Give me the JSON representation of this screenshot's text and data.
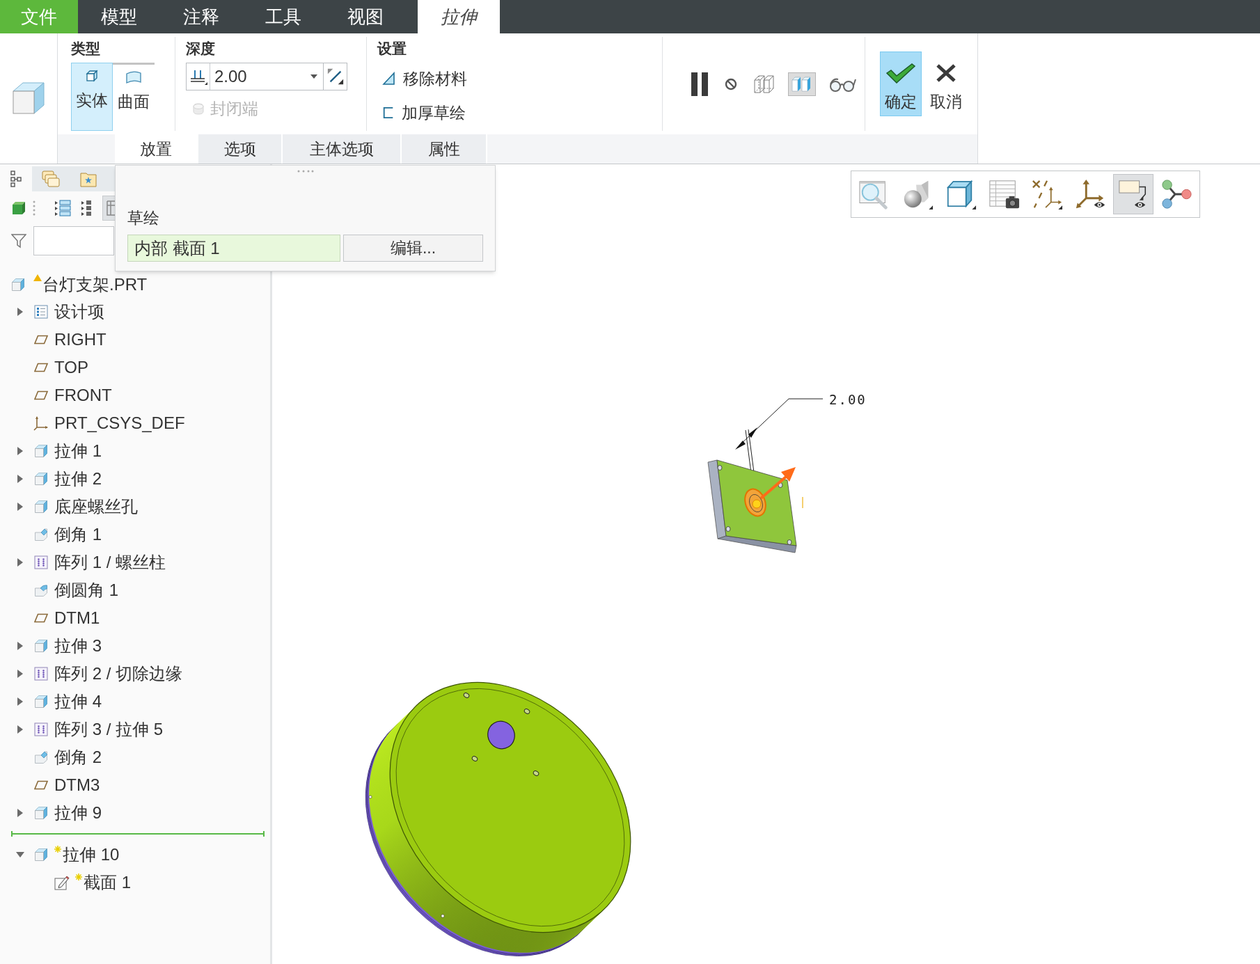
{
  "menu_tabs": [
    {
      "label": "文件",
      "kind": "file",
      "selected": false
    },
    {
      "label": "模型",
      "kind": "tab",
      "selected": false
    },
    {
      "label": "注释",
      "kind": "tab",
      "selected": false
    },
    {
      "label": "工具",
      "kind": "tab",
      "selected": false
    },
    {
      "label": "视图",
      "kind": "tab",
      "selected": false
    },
    {
      "label": "拉伸",
      "kind": "contextual",
      "selected": true
    }
  ],
  "ribbon": {
    "type_group": {
      "title": "类型",
      "options": [
        {
          "label": "实体",
          "kind": "solid",
          "selected": true
        },
        {
          "label": "曲面",
          "kind": "surface",
          "selected": false
        }
      ]
    },
    "depth_group": {
      "title": "深度",
      "value": "2.00",
      "capped_ends": {
        "label": "封闭端",
        "disabled": true
      }
    },
    "settings_group": {
      "title": "设置",
      "options": [
        {
          "label": "移除材料",
          "kind": "remove",
          "selected": false
        },
        {
          "label": "加厚草绘",
          "kind": "thicken",
          "selected": false
        }
      ]
    },
    "preview_buttons": [
      {
        "kind": "pause",
        "selected": false
      },
      {
        "kind": "no-preview",
        "selected": false
      },
      {
        "kind": "wireframe",
        "selected": false
      },
      {
        "kind": "shaded",
        "selected": true
      },
      {
        "kind": "glasses",
        "selected": false
      }
    ],
    "actions": [
      {
        "label": "确定",
        "kind": "confirm",
        "selected": true
      },
      {
        "label": "取消",
        "kind": "cancel",
        "selected": false
      }
    ],
    "sub_tabs": [
      {
        "label": "放置",
        "selected": true
      },
      {
        "label": "选项",
        "selected": false
      },
      {
        "label": "主体选项",
        "selected": false
      },
      {
        "label": "属性",
        "selected": false
      }
    ]
  },
  "placement_panel": {
    "title": "草绘",
    "sketch": "内部 截面 1",
    "edit_button": "编辑..."
  },
  "model_tree": {
    "tabs": [
      {
        "kind": "tree",
        "selected": true
      },
      {
        "kind": "layers",
        "selected": false
      },
      {
        "kind": "favorites",
        "selected": false
      }
    ],
    "root": {
      "label": "台灯支架.PRT",
      "warning": true
    },
    "items": [
      {
        "label": "设计项",
        "kind": "design-items",
        "expanded": false
      },
      {
        "label": "RIGHT",
        "kind": "plane"
      },
      {
        "label": "TOP",
        "kind": "plane"
      },
      {
        "label": "FRONT",
        "kind": "plane"
      },
      {
        "label": "PRT_CSYS_DEF",
        "kind": "csys"
      },
      {
        "label": "拉伸 1",
        "kind": "extrude",
        "expanded": false
      },
      {
        "label": "拉伸 2",
        "kind": "extrude",
        "expanded": false
      },
      {
        "label": "底座螺丝孔",
        "kind": "extrude",
        "expanded": false
      },
      {
        "label": "倒角 1",
        "kind": "chamfer"
      },
      {
        "label": "阵列 1 / 螺丝柱",
        "kind": "pattern",
        "expanded": false
      },
      {
        "label": "倒圆角 1",
        "kind": "round"
      },
      {
        "label": "DTM1",
        "kind": "plane"
      },
      {
        "label": "拉伸 3",
        "kind": "extrude",
        "expanded": false
      },
      {
        "label": "阵列 2 / 切除边缘",
        "kind": "pattern",
        "expanded": false
      },
      {
        "label": "拉伸 4",
        "kind": "extrude",
        "expanded": false
      },
      {
        "label": "阵列 3 / 拉伸 5",
        "kind": "pattern",
        "expanded": false
      },
      {
        "label": "倒角 2",
        "kind": "chamfer"
      },
      {
        "label": "DTM3",
        "kind": "plane"
      },
      {
        "label": "拉伸 9",
        "kind": "extrude",
        "expanded": false
      },
      {
        "kind": "insert-marker"
      },
      {
        "label": "拉伸 10",
        "kind": "extrude",
        "expanded": true,
        "new": true,
        "children": [
          {
            "label": "截面 1",
            "kind": "sketch",
            "new": true
          }
        ]
      }
    ]
  },
  "view_toolbar": [
    {
      "kind": "zoom",
      "selected": false
    },
    {
      "kind": "display-style",
      "selected": false
    },
    {
      "kind": "orientation",
      "selected": false
    },
    {
      "kind": "views",
      "selected": false
    },
    {
      "kind": "datum",
      "selected": false
    },
    {
      "kind": "annotation",
      "selected": false
    },
    {
      "kind": "note",
      "selected": true
    },
    {
      "kind": "nodes",
      "selected": false
    }
  ],
  "canvas": {
    "dimension": "2.00"
  }
}
